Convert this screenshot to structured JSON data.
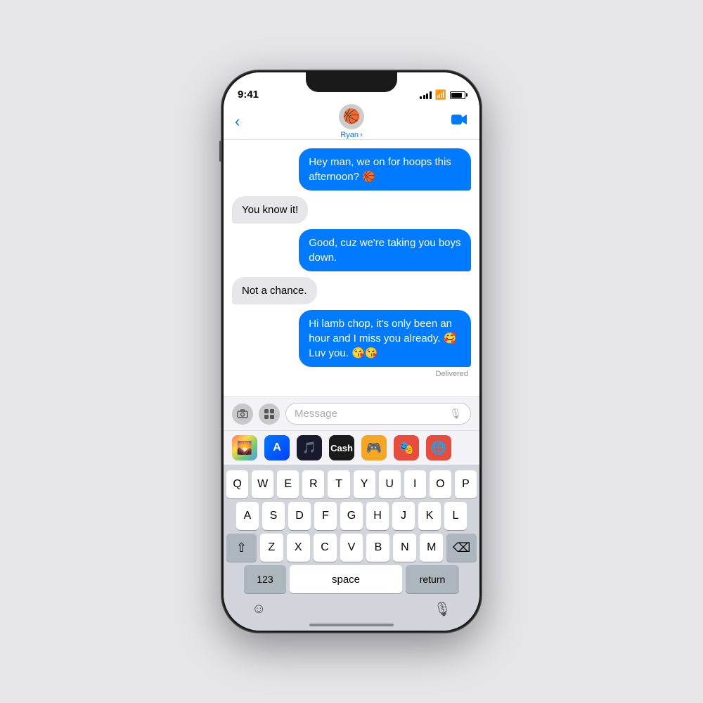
{
  "status_bar": {
    "time": "9:41",
    "battery_level": "85"
  },
  "nav": {
    "back_label": "‹",
    "contact_name": "Ryan",
    "contact_name_chevron": "›",
    "contact_emoji": "🏀",
    "video_icon": "📹"
  },
  "messages": [
    {
      "id": "msg1",
      "type": "sent",
      "text": "Hey man, we on for hoops this afternoon? 🏀"
    },
    {
      "id": "msg2",
      "type": "received",
      "text": "You know it!"
    },
    {
      "id": "msg3",
      "type": "sent",
      "text": "Good, cuz we're taking you boys down."
    },
    {
      "id": "msg4",
      "type": "received",
      "text": "Not a chance."
    },
    {
      "id": "msg5",
      "type": "sent",
      "text": "Hi lamb chop, it's only been an hour and I miss you already. 🥰 Luv you. 😘😘"
    }
  ],
  "delivered_label": "Delivered",
  "input": {
    "placeholder": "Message",
    "camera_icon": "📷",
    "apps_icon": "A",
    "mic_icon": "🎙"
  },
  "app_row": {
    "icons": [
      "🌄",
      "📱",
      "🎵",
      "💲",
      "🎮",
      "🎭",
      "🌐"
    ]
  },
  "keyboard": {
    "rows": [
      [
        "Q",
        "W",
        "E",
        "R",
        "T",
        "Y",
        "U",
        "I",
        "O",
        "P"
      ],
      [
        "A",
        "S",
        "D",
        "F",
        "G",
        "H",
        "J",
        "K",
        "L"
      ],
      [
        "⇧",
        "Z",
        "X",
        "C",
        "V",
        "B",
        "N",
        "M",
        "⌫"
      ]
    ],
    "bottom": [
      "123",
      "space",
      "return"
    ]
  },
  "bottom_bar": {
    "emoji_icon": "☺",
    "mic_icon": "🎙"
  }
}
